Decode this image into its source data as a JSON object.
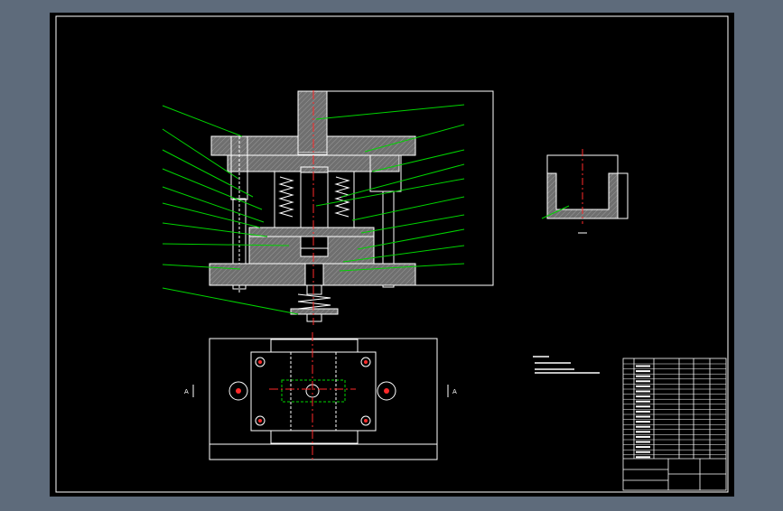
{
  "colors": {
    "app_background": "#5e6b7b",
    "canvas": "#000000",
    "line": "#ffffff",
    "leader": "#00d400",
    "centerline": "#ff2a2a",
    "section_fill": "#7a7a7a"
  },
  "labels": {
    "left_section_mark": "A",
    "right_section_mark": "A"
  }
}
